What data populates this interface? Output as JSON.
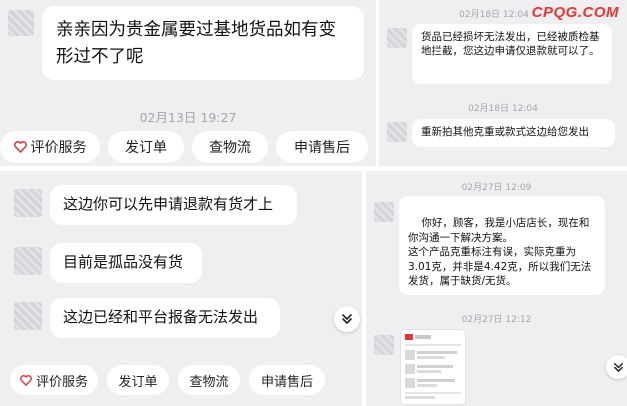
{
  "brand_watermark": "CPQG.COM",
  "panel1": {
    "message": "亲亲因为贵金属要过基地货品如有变形过不了呢",
    "timestamp": "02月13日 19:27",
    "actions": [
      "评价服务",
      "发订单",
      "查物流",
      "申请售后"
    ]
  },
  "panel2": {
    "timestamp_top": "02月18日 12:04",
    "message1": "货品已经损坏无法发出，已经被质检基地拦截，您这边申请仅退款就可以了。",
    "timestamp_mid": "02月18日 12:04",
    "message2": "重新拍其他克重或款式这边给您发出"
  },
  "panel3": {
    "messages": [
      "这边你可以先申请退款有货才上",
      "目前是孤品没有货",
      "这边已经和平台报备无法发出"
    ],
    "actions": [
      "评价服务",
      "发订单",
      "查物流",
      "申请售后"
    ]
  },
  "panel4": {
    "timestamp1": "02月27日 12:09",
    "message": "你好，顾客，我是小店店长，现在和你沟通一下解决方案。\n这个产品克重标注有误，实际克重为3.01克，并非是4.42克，所以我们无法发货，属于缺货/无货。",
    "timestamp2": "02月27日 12:12"
  },
  "colors": {
    "panel_bg": "#efeff2",
    "bubble_bg": "#ffffff",
    "accent_red": "#e8362f",
    "timestamp": "#a5a5aa"
  },
  "icons": {
    "service": "heart-icon",
    "scroll_down": "chevron-double-down-icon"
  }
}
